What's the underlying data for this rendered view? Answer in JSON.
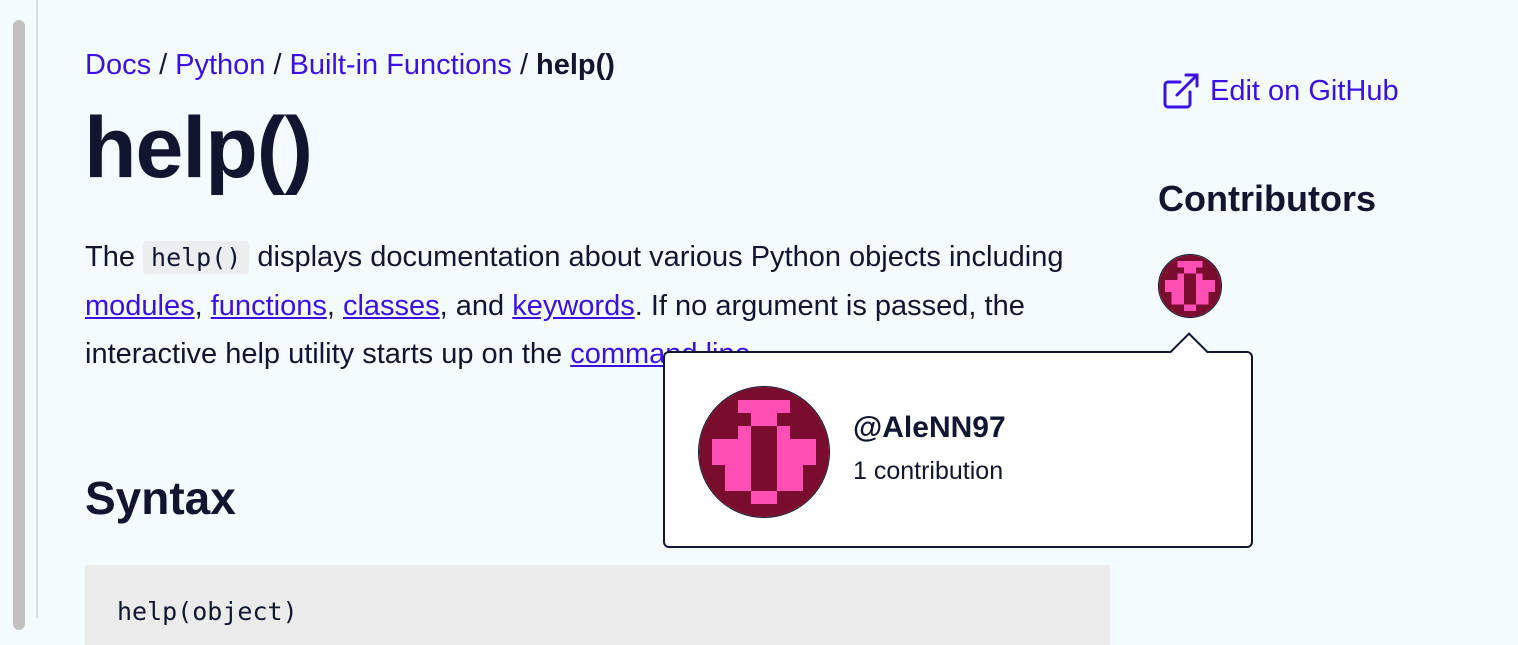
{
  "breadcrumb": {
    "items": [
      "Docs",
      "Python",
      "Built-in Functions"
    ],
    "separator": "/",
    "current": "help()"
  },
  "page": {
    "title": "help()",
    "intro": {
      "part1": "The ",
      "code": "help()",
      "part2": " displays documentation about various Python objects including ",
      "link_modules": "modules",
      "comma1": ", ",
      "link_functions": "functions",
      "comma2": ", ",
      "link_classes": "classes",
      "part3": ", and ",
      "link_keywords": "keywords",
      "part4": ". If no argument is passed, the interactive help utility starts up on the ",
      "link_command_line": "command line"
    },
    "syntax_heading": "Syntax",
    "syntax_code": "help(object)"
  },
  "sidebar": {
    "edit_link": "Edit on GitHub",
    "edit_icon": "external-link-icon",
    "contributors_heading": "Contributors"
  },
  "popover": {
    "username": "@AleNN97",
    "contributions": "1 contribution"
  },
  "colors": {
    "link": "#3a10e5",
    "text": "#10162f",
    "background": "#f4fbff",
    "avatar_dark": "#7a0c2e",
    "avatar_light": "#ff4fb4"
  }
}
